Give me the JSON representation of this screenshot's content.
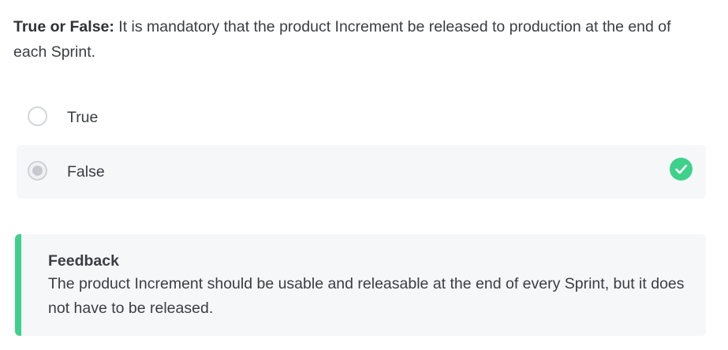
{
  "question": {
    "prefix": "True or False:",
    "text": "It is mandatory that the product Increment be released to production at the end of each Sprint."
  },
  "options": [
    {
      "label": "True",
      "selected": false,
      "correct": false
    },
    {
      "label": "False",
      "selected": true,
      "correct": true
    }
  ],
  "feedback": {
    "title": "Feedback",
    "text": "The product Increment should be usable and releasable at the end of every Sprint, but it does not have to be released."
  },
  "icons": {
    "correct": "check-circle-icon"
  },
  "colors": {
    "accent_green": "#3ed18b",
    "selected_background": "#f6f7f9"
  }
}
